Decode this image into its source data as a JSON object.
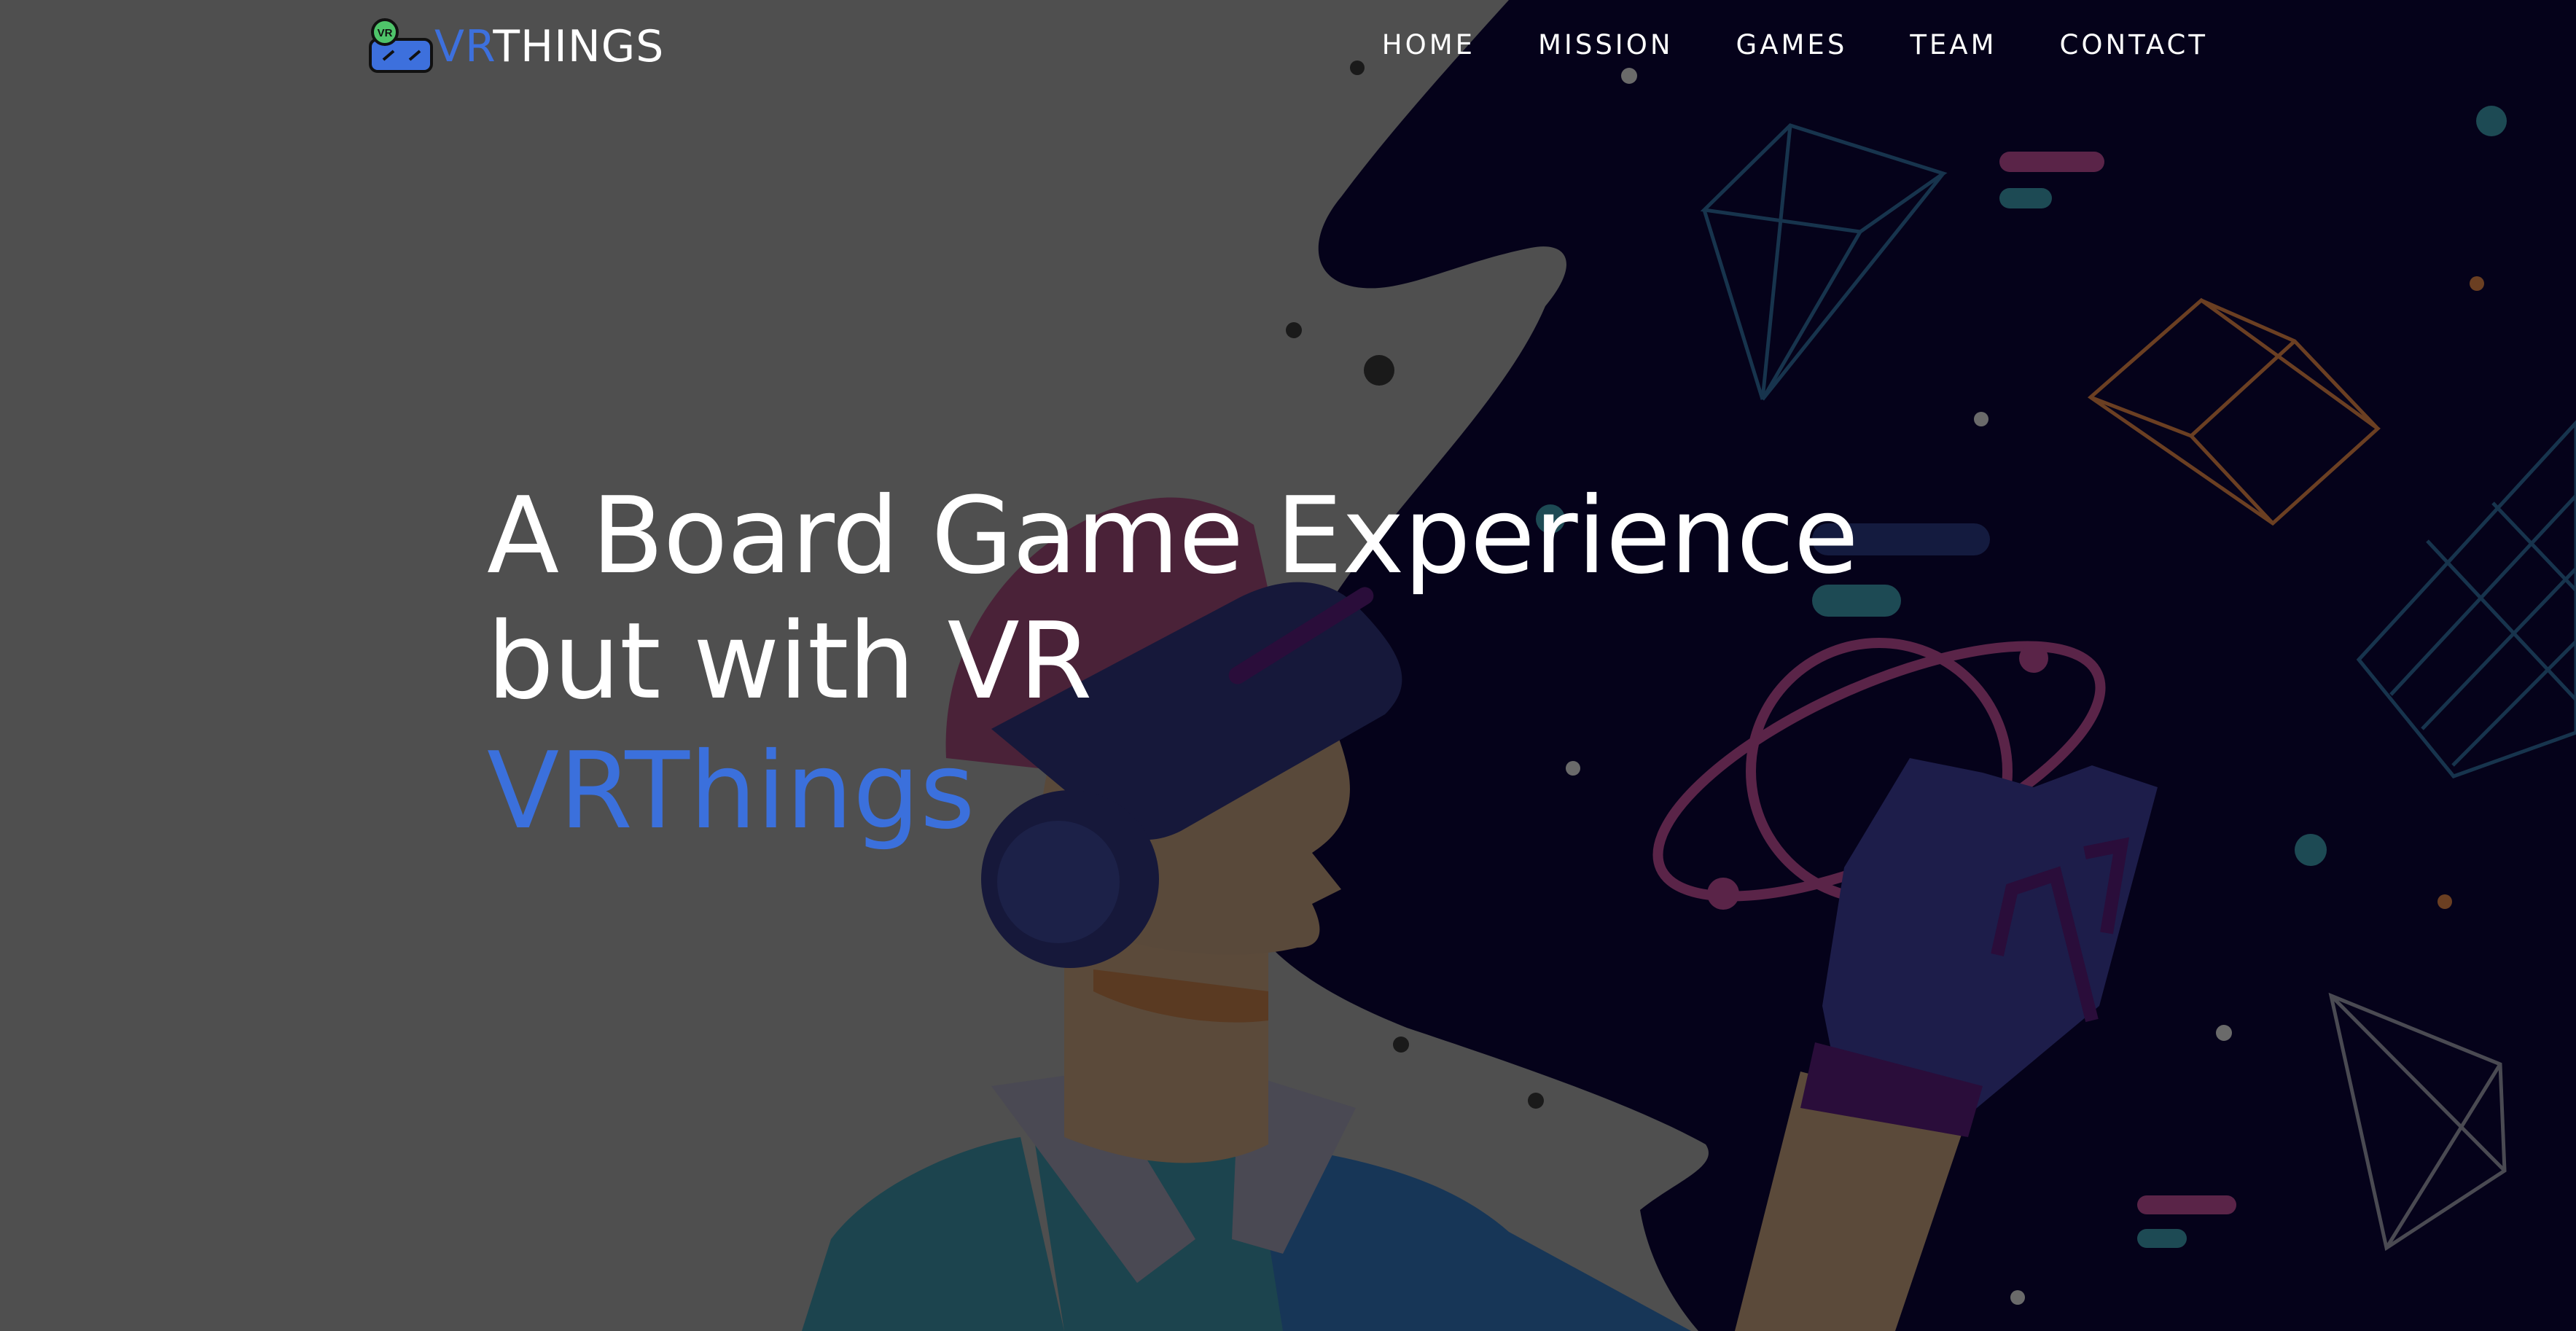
{
  "brand": {
    "badge": "VR",
    "name_accent": "VR",
    "name_rest": "THINGS",
    "accent_color": "#3d70dd"
  },
  "nav": {
    "items": [
      {
        "label": "HOME"
      },
      {
        "label": "MISSION"
      },
      {
        "label": "GAMES"
      },
      {
        "label": "TEAM"
      },
      {
        "label": "CONTACT"
      }
    ]
  },
  "hero": {
    "headline_line1": "A Board Game Experience",
    "headline_line2": "but with VR",
    "subtitle": "VRThings",
    "subtitle_color": "#3b70dc",
    "overlay_color": "#4f4f4f",
    "space_color": "#05021a"
  }
}
